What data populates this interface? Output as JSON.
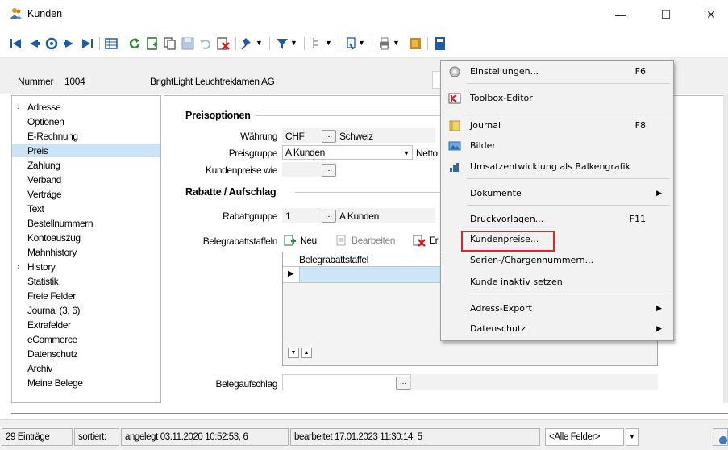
{
  "window": {
    "title": "Kunden",
    "controls": {
      "minimize": "—",
      "maximize": "☐",
      "close": "✕"
    }
  },
  "header": {
    "number_label": "Nummer",
    "number_value": "1004",
    "company_name": "BrightLight Leuchtreklamen AG"
  },
  "sidebar": {
    "items": [
      {
        "label": "Adresse",
        "expandable": true
      },
      {
        "label": "Optionen"
      },
      {
        "label": "E-Rechnung"
      },
      {
        "label": "Preis",
        "selected": true
      },
      {
        "label": "Zahlung"
      },
      {
        "label": "Verband"
      },
      {
        "label": "Verträge"
      },
      {
        "label": "Text"
      },
      {
        "label": "Bestellnummern"
      },
      {
        "label": "Kontoauszug"
      },
      {
        "label": "Mahnhistory"
      },
      {
        "label": "History",
        "expandable": true
      },
      {
        "label": "Statistik"
      },
      {
        "label": "Freie Felder"
      },
      {
        "label": "Journal (3, 6)"
      },
      {
        "label": "Extrafelder"
      },
      {
        "label": "eCommerce"
      },
      {
        "label": "Datenschutz"
      },
      {
        "label": "Archiv"
      },
      {
        "label": "Meine Belege"
      }
    ]
  },
  "preisoptionen": {
    "title": "Preisoptionen",
    "waehrung_label": "Währung",
    "waehrung_value": "CHF",
    "waehrung_name": "Schweiz",
    "preisgruppe_label": "Preisgruppe",
    "preisgruppe_value": "A Kunden",
    "preisgruppe_extra": "Netto",
    "kundenpreise_label": "Kundenpreise wie"
  },
  "rabatte": {
    "title": "Rabatte / Aufschlag",
    "rabattgruppe_label": "Rabattgruppe",
    "rabattgruppe_value": "1",
    "rabattgruppe_name": "A Kunden",
    "staffeln_label": "Belegrabattstaffeln",
    "grid_toolbar": {
      "new": "Neu",
      "edit": "Bearbeiten",
      "delete": "Er"
    },
    "grid_column": "Belegrabattstaffel",
    "belegaufschlag_label": "Belegaufschlag"
  },
  "statusbar": {
    "count": "29 Einträge",
    "sorted": "sortiert:",
    "created": "angelegt 03.11.2020 10:52:53,  6",
    "edited": "bearbeitet 17.01.2023 11:30:14,  5",
    "fields": "<Alle Felder>"
  },
  "menu": {
    "items": [
      {
        "label": "Einstellungen...",
        "shortcut": "F6",
        "icon": "gear-icon"
      },
      {
        "label": "Toolbox-Editor",
        "icon": "toolbox-icon"
      },
      {
        "label": "Journal",
        "shortcut": "F8",
        "icon": "journal-icon"
      },
      {
        "label": "Bilder",
        "icon": "image-icon"
      },
      {
        "label": "Umsatzentwicklung als Balkengrafik",
        "icon": "bar-chart-icon"
      },
      {
        "label": "Dokumente",
        "submenu": true
      },
      {
        "label": "Druckvorlagen...",
        "shortcut": "F11"
      },
      {
        "label": "Kundenpreise..."
      },
      {
        "label": "Serien-/Chargennummern..."
      },
      {
        "label": "Kunde inaktiv setzen"
      },
      {
        "label": "Adress-Export",
        "submenu": true
      },
      {
        "label": "Datenschutz",
        "submenu": true
      }
    ]
  },
  "colors": {
    "selection": "#cce4f7",
    "highlight_border": "#e0242a",
    "toolbar_blue": "#1f5aa6"
  }
}
